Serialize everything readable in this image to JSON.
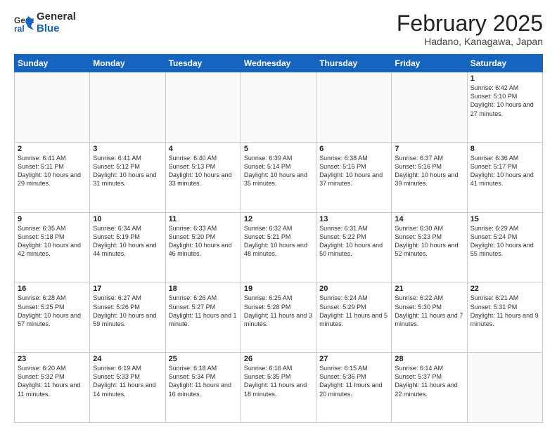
{
  "header": {
    "logo": {
      "line1": "General",
      "line2": "Blue"
    },
    "title": "February 2025",
    "location": "Hadano, Kanagawa, Japan"
  },
  "weekdays": [
    "Sunday",
    "Monday",
    "Tuesday",
    "Wednesday",
    "Thursday",
    "Friday",
    "Saturday"
  ],
  "weeks": [
    [
      {
        "day": "",
        "info": ""
      },
      {
        "day": "",
        "info": ""
      },
      {
        "day": "",
        "info": ""
      },
      {
        "day": "",
        "info": ""
      },
      {
        "day": "",
        "info": ""
      },
      {
        "day": "",
        "info": ""
      },
      {
        "day": "1",
        "info": "Sunrise: 6:42 AM\nSunset: 5:10 PM\nDaylight: 10 hours and 27 minutes."
      }
    ],
    [
      {
        "day": "2",
        "info": "Sunrise: 6:41 AM\nSunset: 5:11 PM\nDaylight: 10 hours and 29 minutes."
      },
      {
        "day": "3",
        "info": "Sunrise: 6:41 AM\nSunset: 5:12 PM\nDaylight: 10 hours and 31 minutes."
      },
      {
        "day": "4",
        "info": "Sunrise: 6:40 AM\nSunset: 5:13 PM\nDaylight: 10 hours and 33 minutes."
      },
      {
        "day": "5",
        "info": "Sunrise: 6:39 AM\nSunset: 5:14 PM\nDaylight: 10 hours and 35 minutes."
      },
      {
        "day": "6",
        "info": "Sunrise: 6:38 AM\nSunset: 5:15 PM\nDaylight: 10 hours and 37 minutes."
      },
      {
        "day": "7",
        "info": "Sunrise: 6:37 AM\nSunset: 5:16 PM\nDaylight: 10 hours and 39 minutes."
      },
      {
        "day": "8",
        "info": "Sunrise: 6:36 AM\nSunset: 5:17 PM\nDaylight: 10 hours and 41 minutes."
      }
    ],
    [
      {
        "day": "9",
        "info": "Sunrise: 6:35 AM\nSunset: 5:18 PM\nDaylight: 10 hours and 42 minutes."
      },
      {
        "day": "10",
        "info": "Sunrise: 6:34 AM\nSunset: 5:19 PM\nDaylight: 10 hours and 44 minutes."
      },
      {
        "day": "11",
        "info": "Sunrise: 6:33 AM\nSunset: 5:20 PM\nDaylight: 10 hours and 46 minutes."
      },
      {
        "day": "12",
        "info": "Sunrise: 6:32 AM\nSunset: 5:21 PM\nDaylight: 10 hours and 48 minutes."
      },
      {
        "day": "13",
        "info": "Sunrise: 6:31 AM\nSunset: 5:22 PM\nDaylight: 10 hours and 50 minutes."
      },
      {
        "day": "14",
        "info": "Sunrise: 6:30 AM\nSunset: 5:23 PM\nDaylight: 10 hours and 52 minutes."
      },
      {
        "day": "15",
        "info": "Sunrise: 6:29 AM\nSunset: 5:24 PM\nDaylight: 10 hours and 55 minutes."
      }
    ],
    [
      {
        "day": "16",
        "info": "Sunrise: 6:28 AM\nSunset: 5:25 PM\nDaylight: 10 hours and 57 minutes."
      },
      {
        "day": "17",
        "info": "Sunrise: 6:27 AM\nSunset: 5:26 PM\nDaylight: 10 hours and 59 minutes."
      },
      {
        "day": "18",
        "info": "Sunrise: 6:26 AM\nSunset: 5:27 PM\nDaylight: 11 hours and 1 minute."
      },
      {
        "day": "19",
        "info": "Sunrise: 6:25 AM\nSunset: 5:28 PM\nDaylight: 11 hours and 3 minutes."
      },
      {
        "day": "20",
        "info": "Sunrise: 6:24 AM\nSunset: 5:29 PM\nDaylight: 11 hours and 5 minutes."
      },
      {
        "day": "21",
        "info": "Sunrise: 6:22 AM\nSunset: 5:30 PM\nDaylight: 11 hours and 7 minutes."
      },
      {
        "day": "22",
        "info": "Sunrise: 6:21 AM\nSunset: 5:31 PM\nDaylight: 11 hours and 9 minutes."
      }
    ],
    [
      {
        "day": "23",
        "info": "Sunrise: 6:20 AM\nSunset: 5:32 PM\nDaylight: 11 hours and 11 minutes."
      },
      {
        "day": "24",
        "info": "Sunrise: 6:19 AM\nSunset: 5:33 PM\nDaylight: 11 hours and 14 minutes."
      },
      {
        "day": "25",
        "info": "Sunrise: 6:18 AM\nSunset: 5:34 PM\nDaylight: 11 hours and 16 minutes."
      },
      {
        "day": "26",
        "info": "Sunrise: 6:16 AM\nSunset: 5:35 PM\nDaylight: 11 hours and 18 minutes."
      },
      {
        "day": "27",
        "info": "Sunrise: 6:15 AM\nSunset: 5:36 PM\nDaylight: 11 hours and 20 minutes."
      },
      {
        "day": "28",
        "info": "Sunrise: 6:14 AM\nSunset: 5:37 PM\nDaylight: 11 hours and 22 minutes."
      },
      {
        "day": "",
        "info": ""
      }
    ]
  ]
}
